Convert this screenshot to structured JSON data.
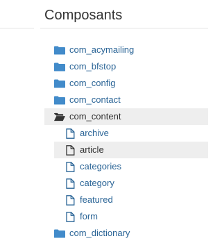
{
  "panel": {
    "title": "Composants"
  },
  "tree": {
    "items": [
      {
        "label": "com_acymailing",
        "icon": "folder-icon"
      },
      {
        "label": "com_bfstop",
        "icon": "folder-icon"
      },
      {
        "label": "com_config",
        "icon": "folder-icon"
      },
      {
        "label": "com_contact",
        "icon": "folder-icon"
      },
      {
        "label": "com_content",
        "icon": "folder-open-icon",
        "expanded": true,
        "children": [
          {
            "label": "archive",
            "icon": "file-icon"
          },
          {
            "label": "article",
            "icon": "file-icon",
            "selected": true
          },
          {
            "label": "categories",
            "icon": "file-icon"
          },
          {
            "label": "category",
            "icon": "file-icon"
          },
          {
            "label": "featured",
            "icon": "file-icon"
          },
          {
            "label": "form",
            "icon": "file-icon"
          }
        ]
      },
      {
        "label": "com_dictionary",
        "icon": "folder-icon"
      }
    ]
  },
  "colors": {
    "link": "#2a6496",
    "folder_icon": "#428bca",
    "selected_bg": "#eeeeee",
    "text_dark": "#333333"
  }
}
